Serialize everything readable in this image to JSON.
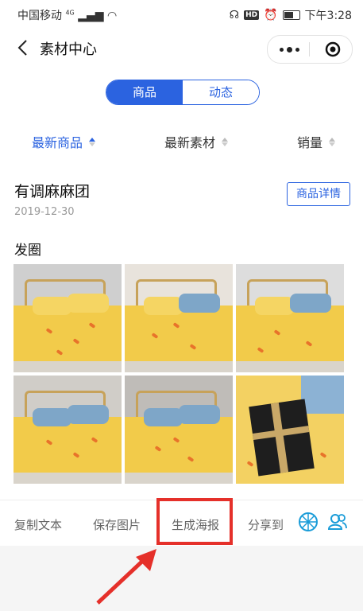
{
  "status": {
    "carrier": "中国移动",
    "signal": "4G",
    "time": "下午3:28",
    "hd": "HD"
  },
  "nav": {
    "title": "素材中心"
  },
  "tabs": [
    {
      "label": "商品",
      "active": true
    },
    {
      "label": "动态",
      "active": false
    }
  ],
  "sort": [
    {
      "label": "最新商品",
      "active": true
    },
    {
      "label": "最新素材",
      "active": false
    },
    {
      "label": "销量",
      "active": false
    }
  ],
  "item": {
    "shop_name": "有调麻麻团",
    "date": "2019-12-30",
    "detail_button": "商品详情",
    "post_label": "发圈"
  },
  "photos": [
    "bedding-photo-1",
    "bedding-photo-2",
    "bedding-photo-3",
    "bedding-photo-4",
    "bedding-photo-5",
    "gift-box-photo"
  ],
  "actions": {
    "copy_text": "复制文本",
    "save_image": "保存图片",
    "make_poster": "生成海报",
    "share_to": "分享到"
  },
  "colors": {
    "accent": "#2b63e0",
    "highlight": "#e5302a",
    "share_icons": "#1a9cd8"
  }
}
